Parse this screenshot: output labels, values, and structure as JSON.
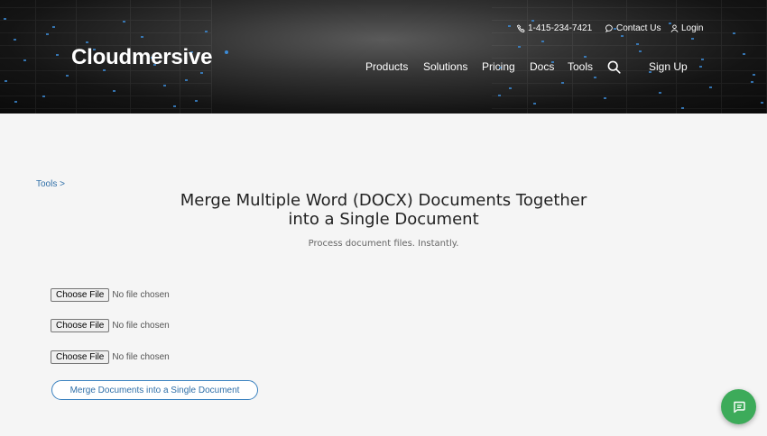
{
  "header": {
    "brand": "Cloudmersive",
    "phone": "1-415-234-7421",
    "contact": "Contact Us",
    "login": "Login",
    "nav": {
      "products": "Products",
      "solutions": "Solutions",
      "pricing": "Pricing",
      "docs": "Docs",
      "tools": "Tools",
      "signup": "Sign Up"
    }
  },
  "breadcrumb": "Tools >",
  "main": {
    "title_line1": "Merge Multiple Word (DOCX) Documents Together",
    "title_line2": "into a Single Document",
    "subtitle": "Process document files. Instantly.",
    "file_inputs": [
      {
        "button": "Choose File",
        "status": "No file chosen"
      },
      {
        "button": "Choose File",
        "status": "No file chosen"
      },
      {
        "button": "Choose File",
        "status": "No file chosen"
      }
    ],
    "merge_button": "Merge Documents into a Single Document"
  },
  "colors": {
    "accent": "#2f6fa8",
    "chat": "#3dab5a",
    "background": "#f5f5f5"
  },
  "icons": {
    "phone": "phone-icon",
    "contact": "chat-bubble-icon",
    "login": "user-icon",
    "search": "search-icon",
    "chat_widget": "chat-icon"
  }
}
